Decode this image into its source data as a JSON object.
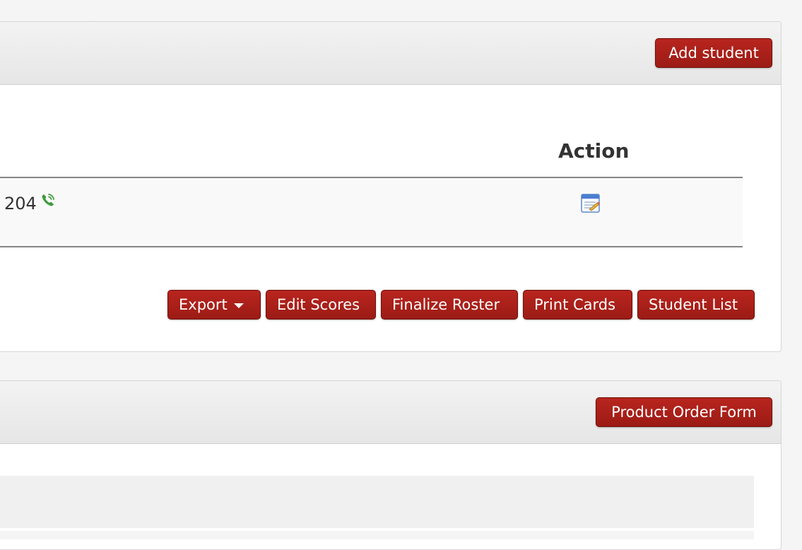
{
  "roster_panel": {
    "add_student_label": "Add student",
    "table": {
      "columns": [
        "Action"
      ],
      "rows": [
        {
          "phone_partial": "204",
          "phone_icon": "phone-icon",
          "action_icon": "edit-form-icon"
        }
      ]
    },
    "actions": {
      "export_label": "Export",
      "edit_scores_label": "Edit Scores",
      "finalize_roster_label": "Finalize Roster",
      "print_cards_label": "Print Cards",
      "student_list_label": "Student List"
    }
  },
  "orders_panel": {
    "product_order_form_label": "Product Order Form"
  },
  "colors": {
    "button_red": "#b8251e",
    "phone_green": "#4caf50",
    "panel_heading": "#e6e6e6"
  }
}
